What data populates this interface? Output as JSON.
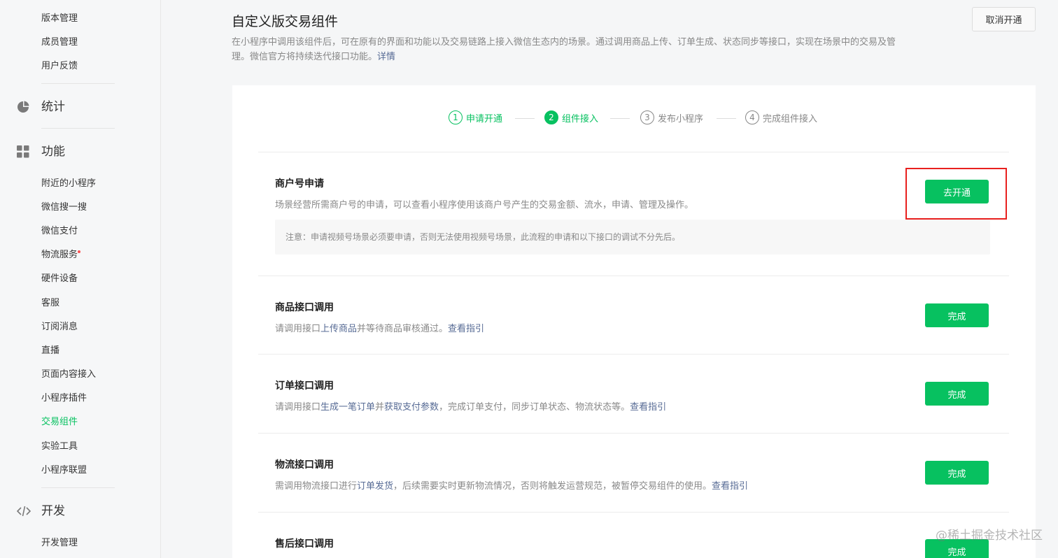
{
  "sidebar": {
    "top_items": [
      "版本管理",
      "成员管理",
      "用户反馈"
    ],
    "stats_group": {
      "label": "统计",
      "icon": "pie-chart-icon"
    },
    "func_group": {
      "label": "功能",
      "icon": "grid-icon"
    },
    "func_items": [
      "附近的小程序",
      "微信搜一搜",
      "微信支付",
      "物流服务",
      "硬件设备",
      "客服",
      "订阅消息",
      "直播",
      "页面内容接入",
      "小程序插件",
      "交易组件",
      "实验工具",
      "小程序联盟"
    ],
    "active_item": "交易组件",
    "dev_group": {
      "label": "开发",
      "icon": "code-icon"
    },
    "dev_items": [
      "开发管理"
    ]
  },
  "header": {
    "title": "自定义版交易组件",
    "desc": "在小程序中调用该组件后，可在原有的界面和功能以及交易链路上接入微信生态内的场景。通过调用商品上传、订单生成、状态同步等接口，实现在场景中的交易及管理。微信官方将持续迭代接口功能。",
    "desc_link": "详情",
    "cancel_label": "取消开通"
  },
  "steps": [
    {
      "num": "1",
      "label": "申请开通",
      "state": "done"
    },
    {
      "num": "2",
      "label": "组件接入",
      "state": "current"
    },
    {
      "num": "3",
      "label": "发布小程序",
      "state": "todo"
    },
    {
      "num": "4",
      "label": "完成组件接入",
      "state": "todo"
    }
  ],
  "sections": {
    "merchant": {
      "title": "商户号申请",
      "desc": "场景经营所需商户号的申请，可以查看小程序使用该商户号产生的交易金额、流水，申请、管理及操作。",
      "notice": "注意：申请视频号场景必须要申请，否则无法使用视频号场景，此流程的申请和以下接口的调试不分先后。",
      "button": "去开通"
    },
    "product": {
      "title": "商品接口调用",
      "desc_a": "请调用接口",
      "link_a": "上传商品",
      "desc_b": "并等待商品审核通过。",
      "guide": "查看指引",
      "button": "完成"
    },
    "order": {
      "title": "订单接口调用",
      "desc_a": "请调用接口",
      "link_a": "生成一笔订单",
      "desc_b": "并",
      "link_b": "获取支付参数",
      "desc_c": "，完成订单支付，同步订单状态、物流状态等。",
      "guide": "查看指引",
      "button": "完成"
    },
    "logistics": {
      "title": "物流接口调用",
      "desc_a": "需调用物流接口进行",
      "link_a": "订单发货",
      "desc_b": "，后续需要实时更新物流情况，否则将触发运营规范，被暂停交易组件的使用。",
      "guide": "查看指引",
      "button": "完成"
    },
    "aftersale": {
      "title": "售后接口调用",
      "button": "完成"
    }
  },
  "watermark": "@稀土掘金技术社区"
}
